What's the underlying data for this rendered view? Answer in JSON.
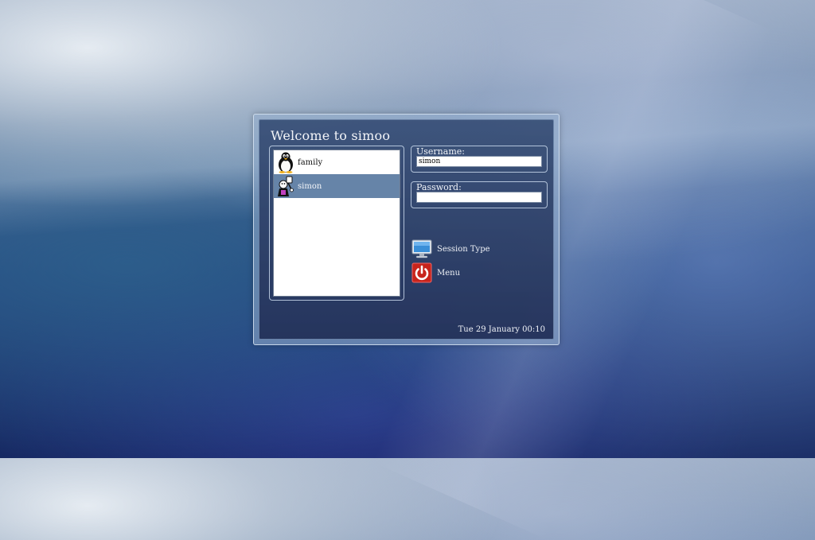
{
  "greeter": {
    "welcome_text": "Welcome to simoo",
    "users": [
      {
        "name": "family",
        "avatar_icon": "tux-penguin-icon",
        "selected": false
      },
      {
        "name": "simon",
        "avatar_icon": "cartoon-character-icon",
        "selected": true
      }
    ],
    "username": {
      "label": "Username:",
      "value": "simon"
    },
    "password": {
      "label": "Password:",
      "value": ""
    },
    "actions": {
      "session_type": {
        "label": "Session Type",
        "icon": "monitor-icon"
      },
      "menu": {
        "label": "Menu",
        "icon": "power-icon"
      }
    },
    "datetime": "Tue 29 January 00:10"
  },
  "colors": {
    "selection": "#6684a8",
    "power_red": "#c8241c",
    "monitor_blue": "#3a8fd8"
  }
}
